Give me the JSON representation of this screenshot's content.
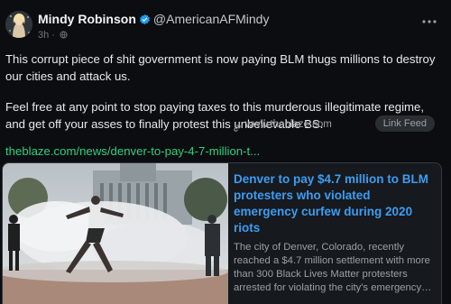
{
  "post": {
    "display_name": "Mindy Robinson",
    "handle": "@AmericanAFMindy",
    "time": "3h",
    "separator": "·",
    "paragraphs": [
      "This corrupt piece of shit government is now paying BLM thugs millions to destroy our cities and attack us.",
      "Feel free at any point to stop paying taxes to this murderous illegitimate regime, and get off your asses to finally protest this unbelievable BS."
    ],
    "link_text": "theblaze.com/news/denver-to-pay-4-7-million-t...",
    "icons": {
      "verified": "verified-badge-icon",
      "audience": "globe-icon",
      "more": "more-dots-icon",
      "link": "link-icon"
    }
  },
  "card": {
    "title": "Denver to pay $4.7 million to BLM protesters who violated emergency curfew during 2020 riots",
    "description": "The city of Denver, Colorado, recently reached a $4.7 million settlement with more than 300 Black Lives Matter protesters arrested for violating the city's emergency…",
    "domain": "www.theblaze.com",
    "button_label": "Link Feed"
  },
  "colors": {
    "background": "#0b0d10",
    "link_green": "#2fd07f",
    "card_title_blue": "#3d9df2",
    "verified_blue": "#1d9bf0"
  }
}
